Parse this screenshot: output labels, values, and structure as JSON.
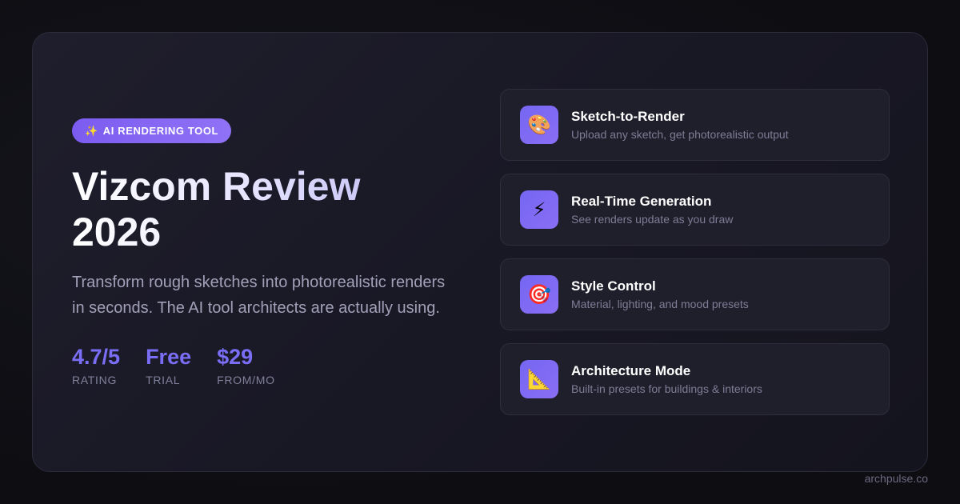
{
  "badge": {
    "icon": "sparkles-icon",
    "glyph": "✨",
    "label": "AI RENDERING TOOL"
  },
  "hero": {
    "title_line1": "Vizcom Review",
    "title_line2": "2026",
    "description": "Transform rough sketches into photorealistic renders in seconds. The AI tool architects are actually using."
  },
  "stats": [
    {
      "value": "4.7/5",
      "label": "RATING"
    },
    {
      "value": "Free",
      "label": "TRIAL"
    },
    {
      "value": "$29",
      "label": "FROM/MO"
    }
  ],
  "features": [
    {
      "icon": "palette-icon",
      "glyph": "🎨",
      "title": "Sketch-to-Render",
      "description": "Upload any sketch, get photorealistic output"
    },
    {
      "icon": "lightning-icon",
      "glyph": "⚡",
      "title": "Real-Time Generation",
      "description": "See renders update as you draw"
    },
    {
      "icon": "target-icon",
      "glyph": "🎯",
      "title": "Style Control",
      "description": "Material, lighting, and mood presets"
    },
    {
      "icon": "triangle-ruler-icon",
      "glyph": "📐",
      "title": "Architecture Mode",
      "description": "Built-in presets for buildings & interiors"
    }
  ],
  "footer": {
    "domain": "archpulse.co"
  },
  "colors": {
    "accent": "#7b6ef6",
    "badge": "#8f72f6",
    "background": "#0e0e13",
    "card": "#1f1e2c"
  }
}
